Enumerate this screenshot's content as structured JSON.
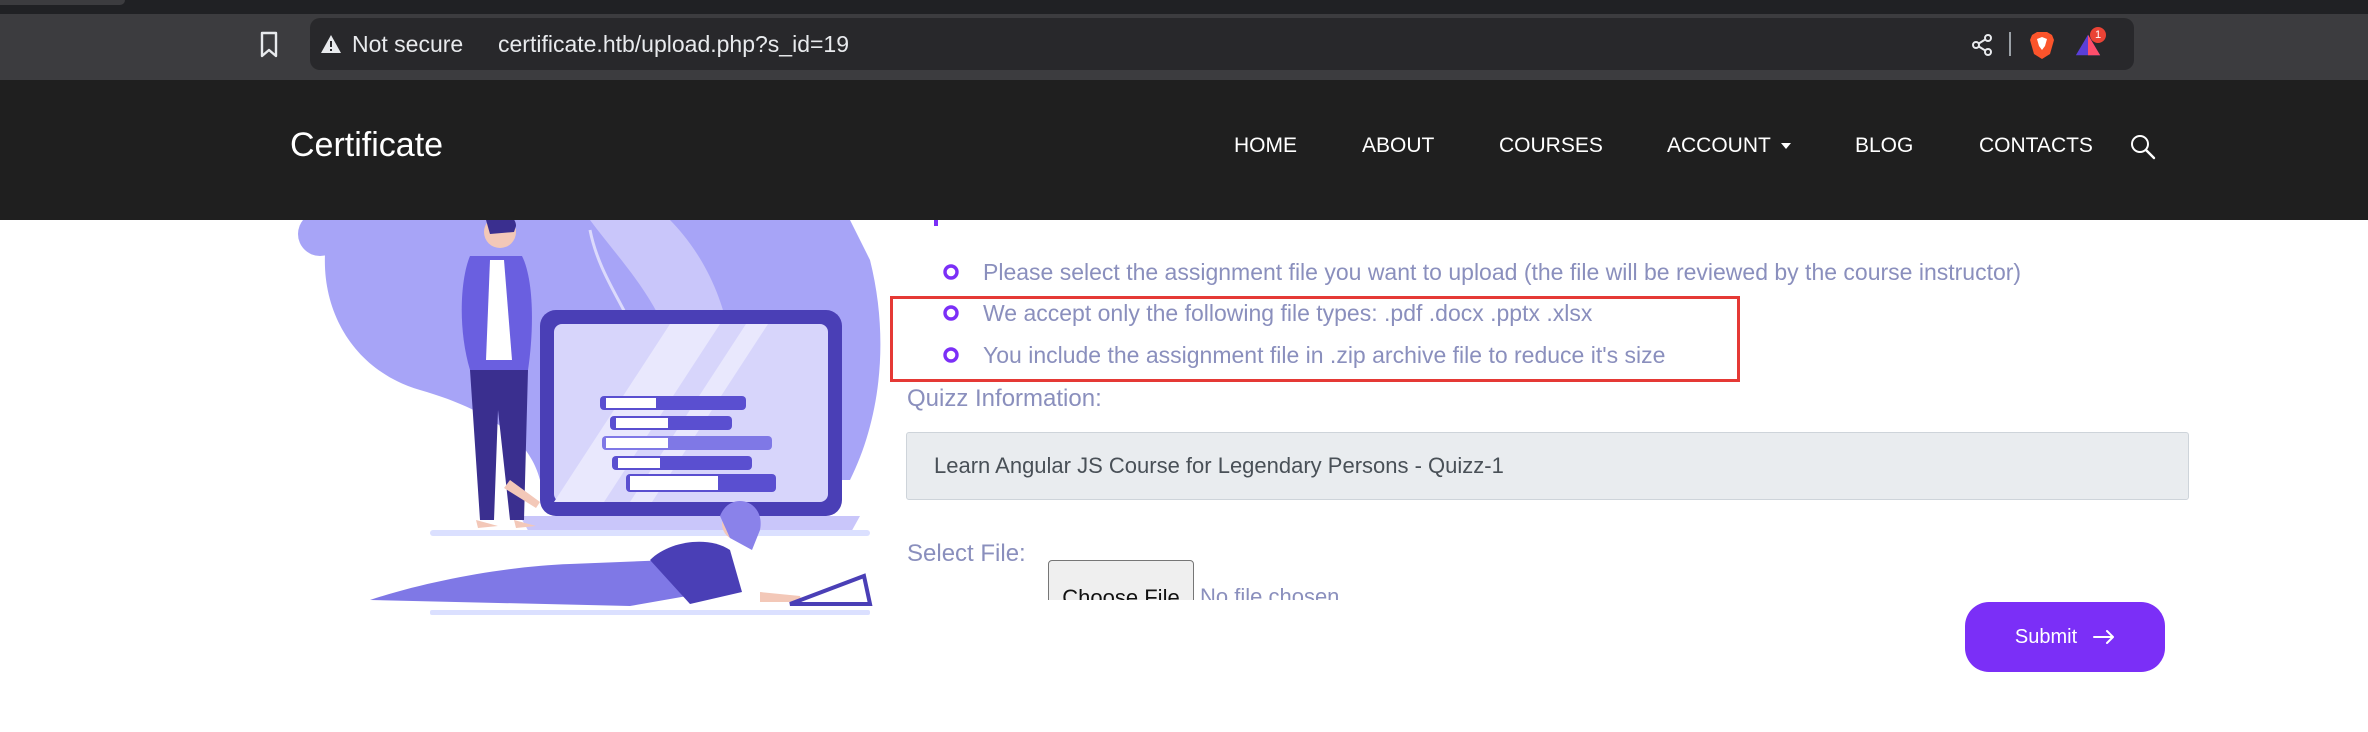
{
  "browser": {
    "security_label": "Not secure",
    "url": "certificate.htb/upload.php?s_id=19",
    "notification_count": "1",
    "icons": [
      "bookmark-icon",
      "warning-icon",
      "share-icon",
      "brave-shield-icon",
      "brave-rewards-icon"
    ]
  },
  "header": {
    "brand": "Certificate",
    "nav": [
      "HOME",
      "ABOUT",
      "COURSES",
      "ACCOUNT",
      "BLOG",
      "CONTACTS"
    ]
  },
  "instructions": [
    "Please select the assignment file you want to upload (the file will be reviewed by the course instructor)",
    "We accept only the following file types: .pdf .docx .pptx .xlsx",
    "You include the assignment file in .zip archive file to reduce it's size"
  ],
  "form": {
    "quiz_label": "Quizz Information:",
    "quiz_value": "Learn Angular JS Course for Legendary Persons - Quizz-1",
    "file_label": "Select File:",
    "choose_file_label": "Choose File",
    "no_file_text": "No file chosen",
    "submit_label": "Submit"
  },
  "colors": {
    "accent": "#7b2ff7",
    "header_bg": "#1f1f1f",
    "muted_text": "#8a8fbd",
    "highlight": "#e53935",
    "illustration": "#a7a4f7"
  }
}
